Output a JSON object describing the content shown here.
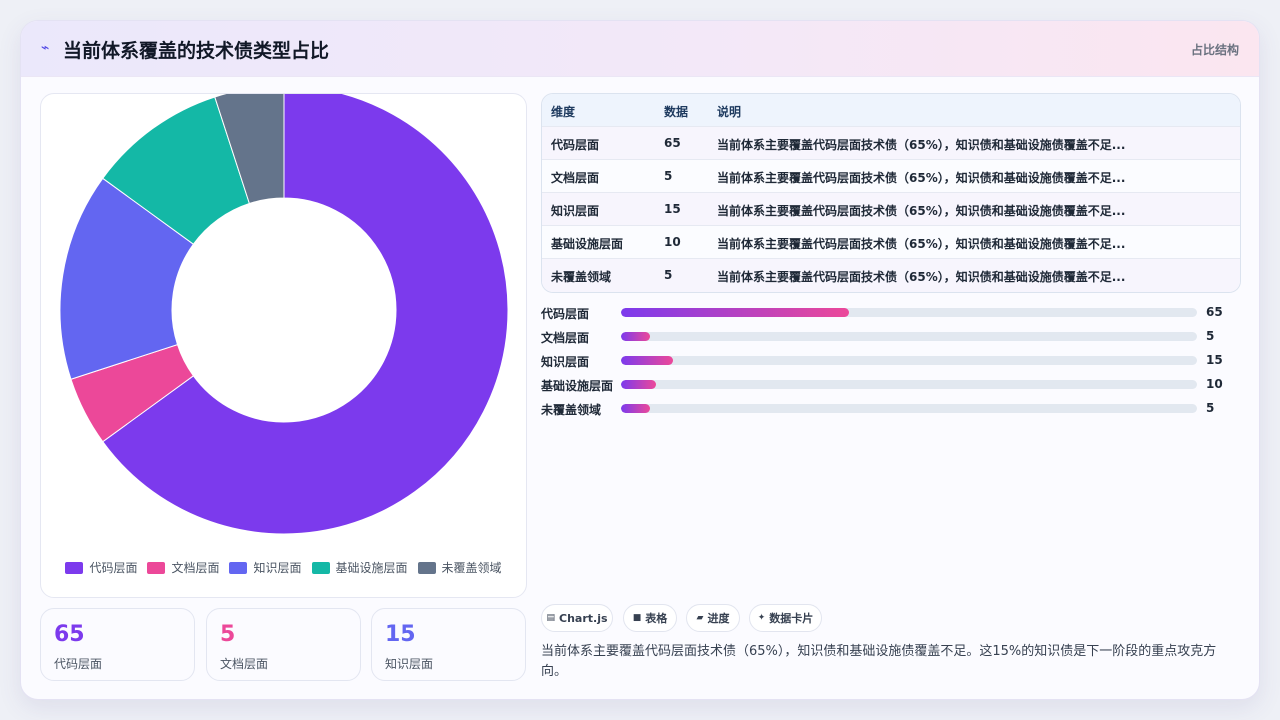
{
  "header": {
    "icon": "lightning-icon",
    "title": "当前体系覆盖的技术债类型占比",
    "tag": "占比结构"
  },
  "colors": {
    "代码层面": "#7c3aed",
    "文档层面": "#ec4899",
    "知识层面": "#6366f1",
    "基础设施层面": "#14b8a6",
    "未覆盖领域": "#64748b"
  },
  "chart_data": {
    "type": "pie",
    "variant": "donut",
    "categories": [
      "代码层面",
      "文档层面",
      "知识层面",
      "基础设施层面",
      "未覆盖领域"
    ],
    "values": [
      65,
      5,
      15,
      10,
      5
    ],
    "legend": "bottom"
  },
  "table": {
    "headers": [
      "维度",
      "数据",
      "说明"
    ],
    "rows": [
      [
        "代码层面",
        "65",
        "当前体系主要覆盖代码层面技术债（65%），知识债和基础设施债覆盖不足..."
      ],
      [
        "文档层面",
        "5",
        "当前体系主要覆盖代码层面技术债（65%），知识债和基础设施债覆盖不足..."
      ],
      [
        "知识层面",
        "15",
        "当前体系主要覆盖代码层面技术债（65%），知识债和基础设施债覆盖不足..."
      ],
      [
        "基础设施层面",
        "10",
        "当前体系主要覆盖代码层面技术债（65%），知识债和基础设施债覆盖不足..."
      ],
      [
        "未覆盖领域",
        "5",
        "当前体系主要覆盖代码层面技术债（65%），知识债和基础设施债覆盖不足..."
      ]
    ]
  },
  "bars": [
    {
      "label": "代码层面",
      "value": "65",
      "fill": 0.395
    },
    {
      "label": "文档层面",
      "value": "5",
      "fill": 0.05
    },
    {
      "label": "知识层面",
      "value": "15",
      "fill": 0.09
    },
    {
      "label": "基础设施层面",
      "value": "10",
      "fill": 0.06
    },
    {
      "label": "未覆盖领域",
      "value": "5",
      "fill": 0.05
    }
  ],
  "kpis": [
    {
      "value": "65",
      "label": "代码层面",
      "color": "#7c3aed"
    },
    {
      "value": "5",
      "label": "文档层面",
      "color": "#ec4899"
    },
    {
      "value": "15",
      "label": "知识层面",
      "color": "#6366f1"
    }
  ],
  "chips": [
    {
      "icon": "▤",
      "label": "Chart.js"
    },
    {
      "icon": "■",
      "label": "表格"
    },
    {
      "icon": "▰",
      "label": "进度"
    },
    {
      "icon": "✦",
      "label": "数据卡片"
    }
  ],
  "summary": "当前体系主要覆盖代码层面技术债（65%），知识债和基础设施债覆盖不足。这15%的知识债是下一阶段的重点攻克方向。"
}
